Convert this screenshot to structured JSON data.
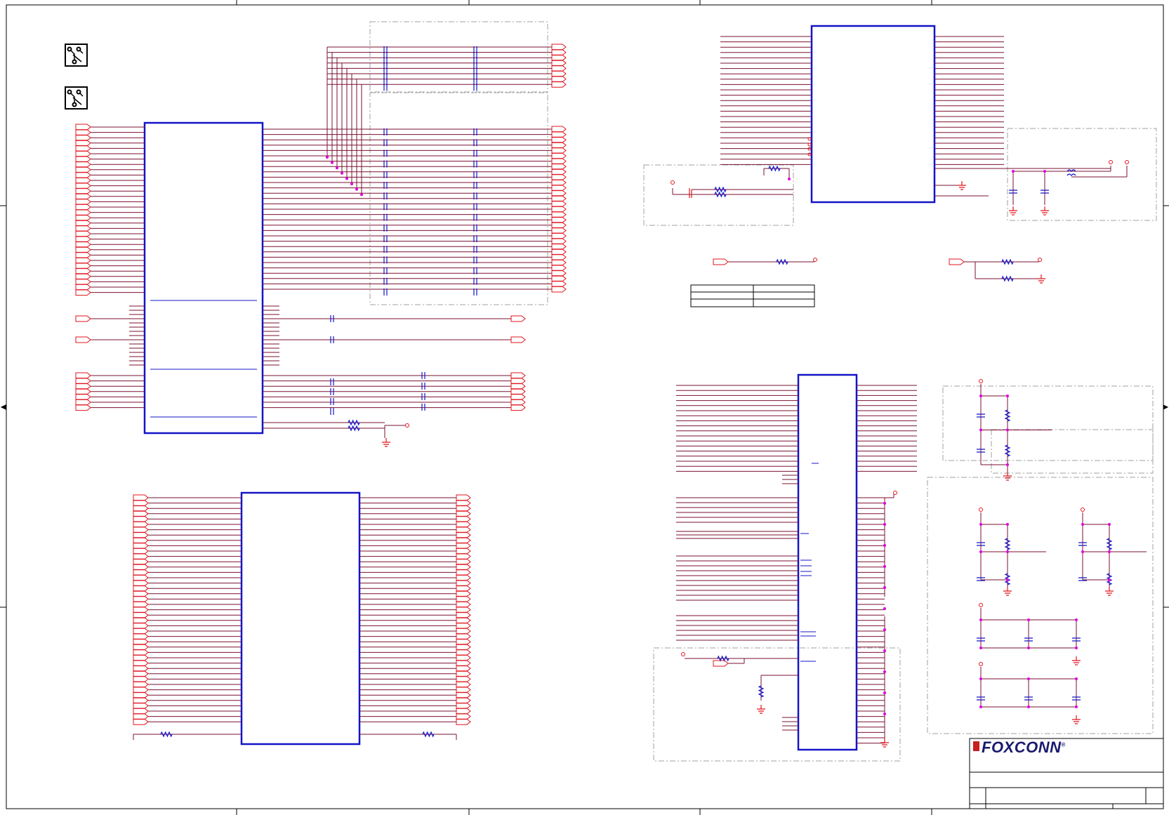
{
  "title_block": {
    "company": "FOXCONN",
    "registered_mark": "®"
  },
  "colors": {
    "wire": "#7a1030",
    "net_label": "#e0141e",
    "component": "#1414c8",
    "junction": "#e000e0",
    "dashed_box": "#a0a0a0",
    "frame": "#000000"
  },
  "icons": [
    "pcb-route-icon",
    "pcb-route-icon"
  ]
}
